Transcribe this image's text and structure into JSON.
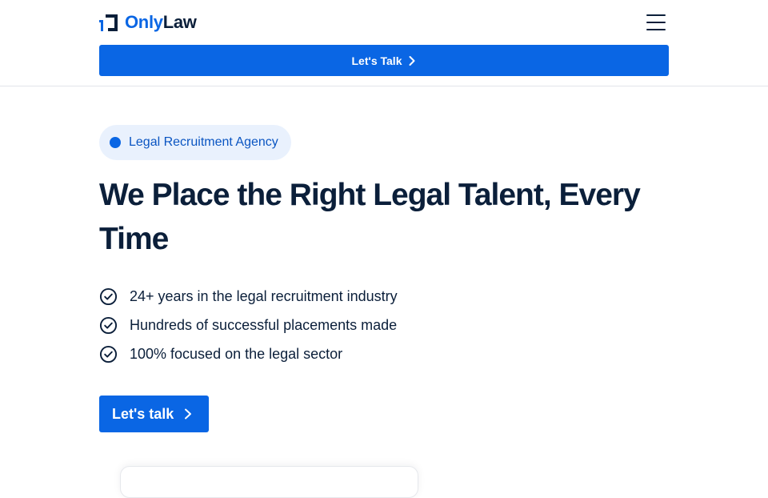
{
  "header": {
    "logo": {
      "icon": "onlylaw-logo-mark",
      "part1": "Only",
      "part2": "Law"
    },
    "menu_icon": "hamburger-menu-icon",
    "cta_label": "Let's Talk"
  },
  "hero": {
    "badge_label": "Legal Recruitment Agency",
    "title": "We Place the Right Legal Talent, Every Time",
    "features": [
      {
        "icon": "check-circle-icon",
        "text": "24+ years in the legal recruitment industry"
      },
      {
        "icon": "check-circle-icon",
        "text": "Hundreds of successful placements made"
      },
      {
        "icon": "check-circle-icon",
        "text": "100% focused on the legal sector"
      }
    ],
    "cta_label": "Let's talk"
  },
  "colors": {
    "brand_blue": "#0a66e4",
    "navy": "#0b1f3a",
    "badge_bg": "#e9f1fd"
  }
}
